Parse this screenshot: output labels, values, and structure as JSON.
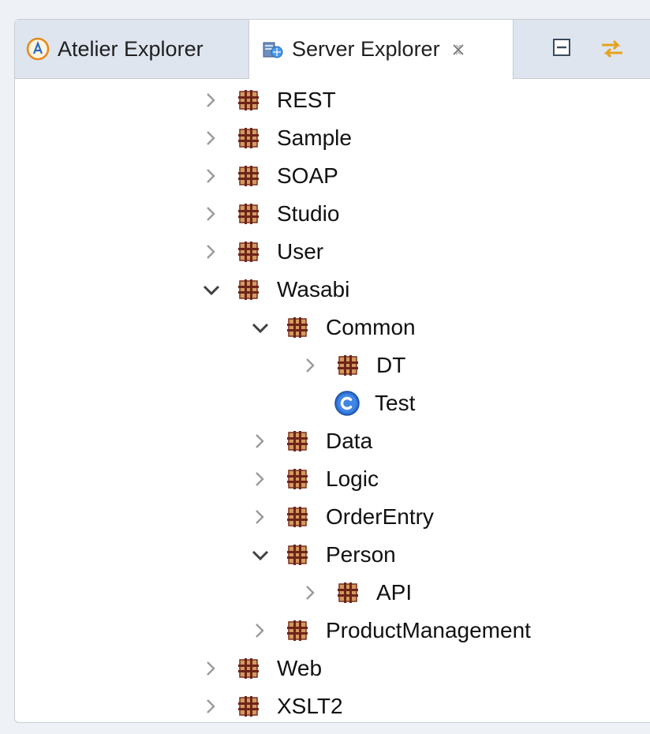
{
  "tabs": {
    "atelier_label": "Atelier Explorer",
    "server_label": "Server Explorer"
  },
  "tree": {
    "rest": "REST",
    "sample": "Sample",
    "soap": "SOAP",
    "studio": "Studio",
    "user": "User",
    "wasabi": "Wasabi",
    "common": "Common",
    "dt": "DT",
    "test": "Test",
    "data": "Data",
    "logic": "Logic",
    "orderentry": "OrderEntry",
    "person": "Person",
    "api": "API",
    "productmanagement": "ProductManagement",
    "web": "Web",
    "xslt2": "XSLT2"
  },
  "icons": {
    "package": "package-icon",
    "class": "class-icon",
    "expanded": "chevron-down-icon",
    "collapsed": "chevron-right-icon"
  },
  "colors": {
    "package_fill": "#c98b4e",
    "package_grid": "#7a2e1c",
    "class_blue": "#2f6fd1",
    "tabbar_bg": "#dee5ef"
  }
}
